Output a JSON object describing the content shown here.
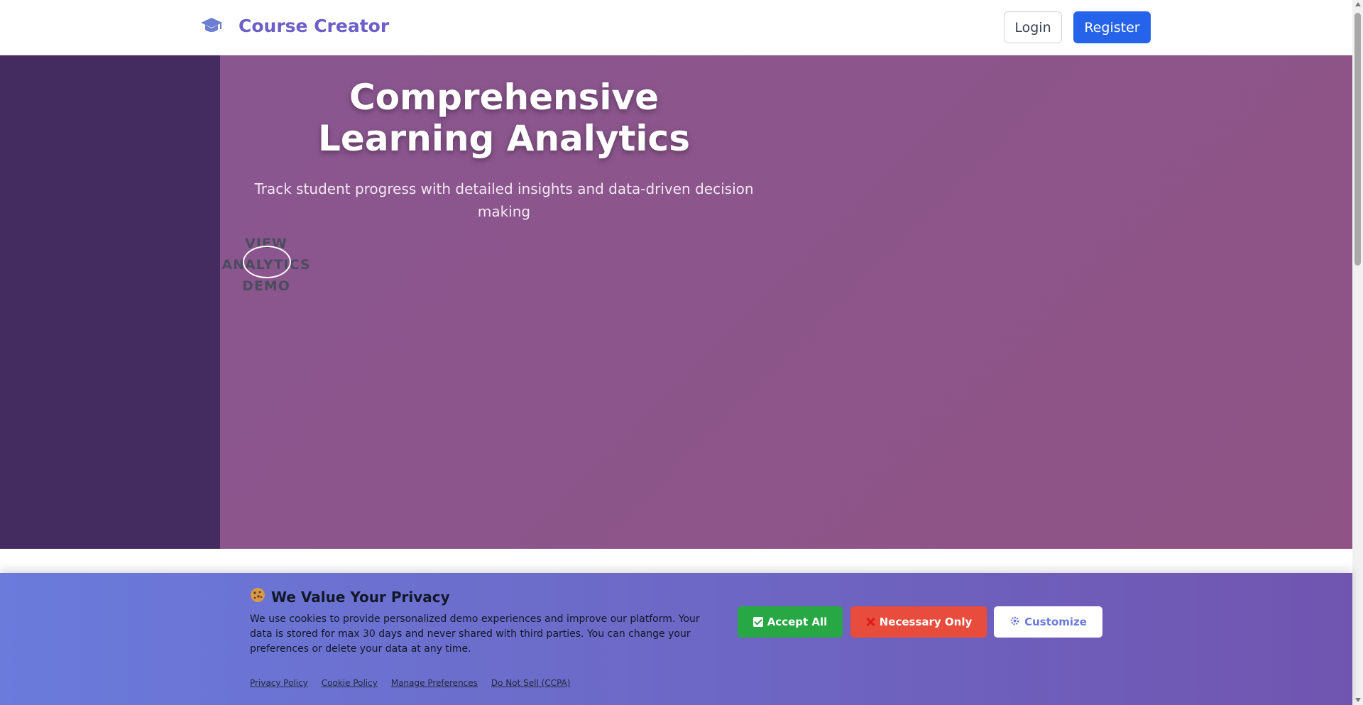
{
  "header": {
    "brand_icon": "graduation-cap-icon",
    "brand_name": "Course Creator",
    "login_label": "Login",
    "register_label": "Register"
  },
  "hero": {
    "title": "Comprehensive Learning Analytics",
    "subtitle": "Track student progress with detailed insights and data-driven decision making",
    "demo_link": "VIEW ANALYTICS DEMO"
  },
  "cookie_banner": {
    "icon": "cookie-icon",
    "title": "We Value Your Privacy",
    "text": "We use cookies to provide personalized demo experiences and improve our platform. Your data is stored for max 30 days and never shared with third parties. You can change your preferences or delete your data at any time.",
    "accept_label": "Accept All",
    "necessary_label": "Necessary Only",
    "customize_label": "Customize",
    "links": {
      "privacy": "Privacy Policy",
      "cookie": "Cookie Policy",
      "manage": "Manage Preferences",
      "ccpa": "Do Not Sell (CCPA)"
    }
  },
  "colors": {
    "brand": "#6d5fc7",
    "register": "#2563eb",
    "hero": "#8a5690",
    "hero_left": "#452c60",
    "accept": "#28a745",
    "necessary": "#e74c3c",
    "banner_start": "#6a7bdc",
    "banner_end": "#7055b0"
  }
}
